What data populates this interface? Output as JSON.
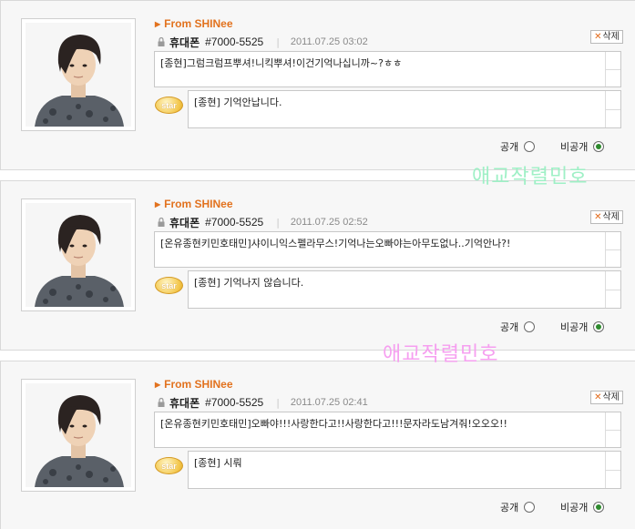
{
  "colors": {
    "accent": "#e2721e",
    "watermark_green": "#9ff0c6",
    "watermark_pink": "#f69ff0"
  },
  "icons": {
    "lock": "lock-icon",
    "star": "star-badge",
    "delete": "x-icon"
  },
  "entries": [
    {
      "from": "From SHINee",
      "kind": "휴대폰",
      "number": "#7000-5525",
      "date": "2011.07.25 03:02",
      "delete_label": "삭제",
      "message": "[종현]그럼크럼프뿌셔!니킥뿌셔!이건기억나십니까~?ㅎㅎ",
      "star_label": "star",
      "reply": "[종현] 기억안납니다.",
      "public_label": "공개",
      "private_label": "비공개",
      "selected": "비공개"
    },
    {
      "from": "From SHINee",
      "kind": "휴대폰",
      "number": "#7000-5525",
      "date": "2011.07.25 02:52",
      "delete_label": "삭제",
      "message": "[온유종현키민호태민]샤이니익스펠라무스!기억나는오빠야는아무도없나..기억안나?!",
      "star_label": "star",
      "reply": "[종현] 기억나지 않습니다.",
      "public_label": "공개",
      "private_label": "비공개",
      "selected": "비공개"
    },
    {
      "from": "From SHINee",
      "kind": "휴대폰",
      "number": "#7000-5525",
      "date": "2011.07.25 02:41",
      "delete_label": "삭제",
      "message": "[온유종현키민호태민]오빠야!!!사랑한다고!!사랑한다고!!!문자라도남겨줘!오오오!!",
      "star_label": "star",
      "reply": "[종현] 시뤄",
      "public_label": "공개",
      "private_label": "비공개",
      "selected": "비공개"
    }
  ],
  "watermarks": [
    "애교작렬민호",
    "애교작렬민호"
  ]
}
